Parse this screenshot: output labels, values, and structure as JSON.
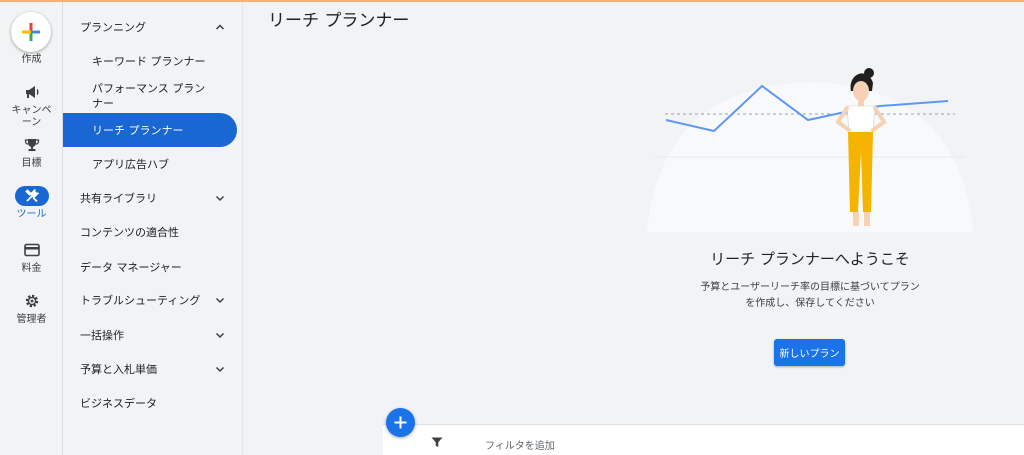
{
  "rail": {
    "create": "作成",
    "campaigns": "キャンペーン",
    "goals": "目標",
    "tools": "ツール",
    "billing": "料金",
    "admin": "管理者"
  },
  "nav": {
    "planning": "プランニング",
    "keyword_planner": "キーワード プランナー",
    "performance_planner": "パフォーマンス プランナー",
    "reach_planner": "リーチ プランナー",
    "app_ad_hub": "アプリ広告ハブ",
    "shared_library": "共有ライブラリ",
    "content_suitability": "コンテンツの適合性",
    "data_manager": "データ マネージャー",
    "troubleshooting": "トラブルシューティング",
    "bulk_actions": "一括操作",
    "budgets_bidding": "予算と入札単価",
    "business_data": "ビジネスデータ"
  },
  "main": {
    "title": "リーチ プランナー",
    "welcome": "リーチ プランナーへようこそ",
    "description": "予算とユーザーリーチ率の目標に基づいてプランを作成し、保存してください",
    "new_plan_button": "新しいプラン",
    "filter_placeholder": "フィルタを追加"
  },
  "colors": {
    "accent": "#1a73e8",
    "active_nav": "#1967d2",
    "top_strip": "#f6b27a"
  }
}
